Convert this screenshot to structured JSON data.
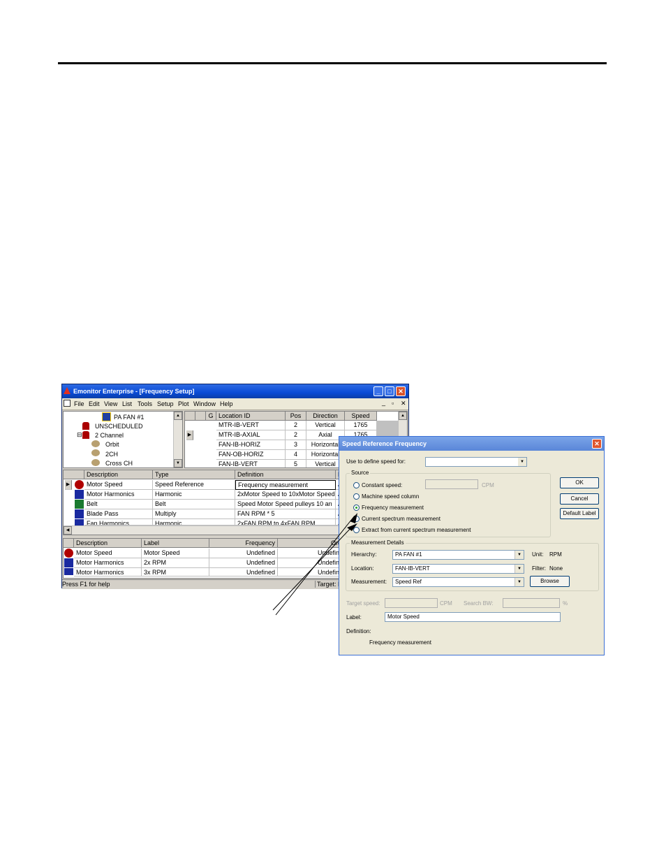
{
  "window": {
    "title": "Emonitor Enterprise - [Frequency Setup]",
    "menu": [
      "File",
      "Edit",
      "View",
      "List",
      "Tools",
      "Setup",
      "Plot",
      "Window",
      "Help"
    ],
    "status_left": "Press F1 for help",
    "status_right": "Target: La"
  },
  "tree": {
    "items": [
      "PA FAN #1",
      "UNSCHEDULED",
      "2 Channel",
      "Orbit",
      "2CH",
      "Cross CH"
    ],
    "expander": "⊟"
  },
  "locations": {
    "headers": [
      "G",
      "Location ID",
      "Pos",
      "Direction",
      "Speed"
    ],
    "rows": [
      {
        "id": "MTR-IB-VERT",
        "pos": "2",
        "dir": "Vertical",
        "speed": "1765"
      },
      {
        "id": "MTR-IB-AXIAL",
        "pos": "2",
        "dir": "Axial",
        "speed": "1765"
      },
      {
        "id": "FAN-IB-HORIZ",
        "pos": "3",
        "dir": "Horizontal",
        "speed": ""
      },
      {
        "id": "FAN-OB-HORIZ",
        "pos": "4",
        "dir": "Horizontal",
        "speed": ""
      },
      {
        "id": "FAN-IB-VERT",
        "pos": "5",
        "dir": "Vertical",
        "speed": ""
      }
    ]
  },
  "frequencies": {
    "headers": [
      "Description",
      "Type",
      "Definition",
      "L"
    ],
    "rows": [
      {
        "desc": "Motor Speed",
        "type": "Speed Reference",
        "def": "Frequency measurement",
        "l": "A"
      },
      {
        "desc": "Motor Harmonics",
        "type": "Harmonic",
        "def": "2xMotor Speed to 10xMotor Speed",
        "l": "A"
      },
      {
        "desc": "Belt",
        "type": "Belt",
        "def": "Speed Motor Speed pulleys 10 an",
        "l": "A"
      },
      {
        "desc": "Blade Pass",
        "type": "Multiply",
        "def": "FAN RPM * 5",
        "l": "A"
      },
      {
        "desc": "Fan Harmonics",
        "type": "Harmonic",
        "def": "2xFAN RPM to 4xFAN RPM",
        "l": "A"
      }
    ]
  },
  "labels_grid": {
    "headers": [
      "Description",
      "Label",
      "Frequency",
      "Orde"
    ],
    "rows": [
      {
        "desc": "Motor Speed",
        "label": "Motor Speed",
        "freq": "Undefined",
        "order": "Undefine"
      },
      {
        "desc": "Motor Harmonics",
        "label": "2x RPM",
        "freq": "Undefined",
        "order": "Undefine"
      },
      {
        "desc": "Motor Harmonics",
        "label": "3x RPM",
        "freq": "Undefined",
        "order": "Undefine"
      }
    ]
  },
  "dialog": {
    "title": "Speed Reference Frequency",
    "use_to_define_label": "Use to define speed for:",
    "use_to_define_value": "",
    "source_caption": "Source",
    "constant_speed": "Constant speed:",
    "constant_unit": "CPM",
    "machine_speed": "Machine speed column",
    "freq_measurement": "Frequency measurement",
    "current_spectrum": "Current spectrum measurement",
    "extract_spectrum": "Extract from current spectrum measurement",
    "ok": "OK",
    "cancel": "Cancel",
    "default_label": "Default Label",
    "details_caption": "Measurement Details",
    "hierarchy_label": "Hierarchy:",
    "hierarchy_value": "PA FAN #1",
    "location_label": "Location:",
    "location_value": "FAN-IB-VERT",
    "measurement_label": "Measurement:",
    "measurement_value": "Speed Ref",
    "unit_label": "Unit:",
    "unit_value": "RPM",
    "filter_label": "Filter:",
    "filter_value": "None",
    "browse": "Browse",
    "target_speed_label": "Target speed:",
    "target_unit": "CPM",
    "search_bw_label": "Search BW:",
    "search_unit": "%",
    "label_label": "Label:",
    "label_value": "Motor Speed",
    "definition_label": "Definition:",
    "definition_value": "Frequency measurement"
  }
}
